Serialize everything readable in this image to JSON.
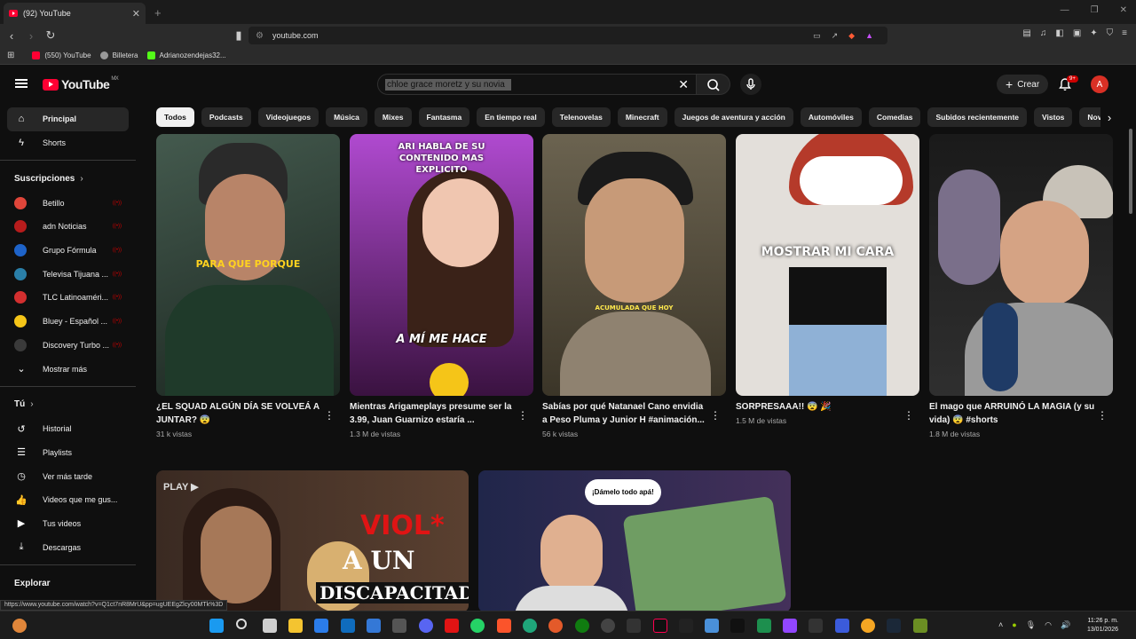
{
  "browser": {
    "tab_title": "(92) YouTube",
    "url": "youtube.com",
    "bookmarks": [
      {
        "label": "(550) YouTube",
        "color": "#ff0033"
      },
      {
        "label": "Billetera",
        "color": "#999999"
      },
      {
        "label": "Adrianozendejas32...",
        "color": "#53fc18"
      }
    ],
    "status_url": "https://www.youtube.com/watch?v=Q1ct7nR8MrU&pp=ugUEEgZlcy00MTk%3D"
  },
  "header": {
    "logo": "YouTube",
    "country": "MX",
    "search_value": "chloe grace moretz y su novia",
    "create_label": "Crear",
    "notif_count": "9+",
    "avatar_letter": "A"
  },
  "sidebar": {
    "main": [
      {
        "label": "Principal",
        "icon": "home-icon",
        "active": true
      },
      {
        "label": "Shorts",
        "icon": "shorts-icon"
      }
    ],
    "subs_title": "Suscripciones",
    "subs": [
      {
        "label": "Betillo",
        "color": "#e0463a"
      },
      {
        "label": "adn Noticias",
        "color": "#b71c1c"
      },
      {
        "label": "Grupo Fórmula",
        "color": "#1e63c9"
      },
      {
        "label": "Televisa Tijuana ...",
        "color": "#2a7fa8"
      },
      {
        "label": "TLC Latinoaméri...",
        "color": "#d32f2f"
      },
      {
        "label": "Bluey - Español ...",
        "color": "#f5c518"
      },
      {
        "label": "Discovery Turbo ...",
        "color": "#3a3a3a"
      }
    ],
    "show_more": "Mostrar más",
    "you_title": "Tú",
    "you": [
      {
        "label": "Historial",
        "icon": "history-icon"
      },
      {
        "label": "Playlists",
        "icon": "playlist-icon"
      },
      {
        "label": "Ver más tarde",
        "icon": "watch-later-icon"
      },
      {
        "label": "Videos que me gus...",
        "icon": "like-icon"
      },
      {
        "label": "Tus videos",
        "icon": "your-videos-icon"
      },
      {
        "label": "Descargas",
        "icon": "download-icon"
      }
    ],
    "explore_title": "Explorar"
  },
  "chips": [
    "Todos",
    "Podcasts",
    "Videojuegos",
    "Música",
    "Mixes",
    "Fantasma",
    "En tiempo real",
    "Telenovelas",
    "Minecraft",
    "Juegos de aventura y acción",
    "Automóviles",
    "Comedias",
    "Subidos recientemente",
    "Vistos",
    "Nove"
  ],
  "shorts": [
    {
      "title": "¿EL SQUAD ALGÚN DÍA SE VOLVEÁ A JUNTAR? 😨",
      "views": "31 k vistas",
      "overlay": "PARA QUE PORQUE",
      "bg": "#2a3a33"
    },
    {
      "title": "Mientras Arigameplays presume ser la 3.99, Juan Guarnizo estaría ...",
      "views": "1.3 M de vistas",
      "overlay": "ARI HABLA DE SU CONTENIDO MAS EXPLICITO",
      "overlay2": "A MÍ ME HACE",
      "bg": "#6a2a7a"
    },
    {
      "title": "Sabías por qué Natanael Cano envidia a Peso Pluma y Junior H #animación...",
      "views": "56 k vistas",
      "overlay": "ACUMULADA QUE HOY",
      "bg": "#5b5340"
    },
    {
      "title": "SORPRESAAA!! 😨 🎉",
      "views": "1.5 M de vistas",
      "overlay": "MOSTRAR MI CARA",
      "bg": "#d7d2cc"
    },
    {
      "title": "El mago que ARRUINÓ LA MAGIA (y su vida) 😨 #shorts",
      "views": "1.8 M de vistas",
      "overlay": "",
      "bg": "#3a3a3a"
    }
  ],
  "videos": [
    {
      "overlay1": "VIOL*",
      "overlay2": "A UN",
      "overlay3": "DISCAPACITADO",
      "badge": "PLAY ▶"
    },
    {
      "bubble": "¡Dámelo todo apá!"
    }
  ],
  "taskbar": {
    "time": "11:26 p. m.",
    "date": "13/01/2026"
  }
}
